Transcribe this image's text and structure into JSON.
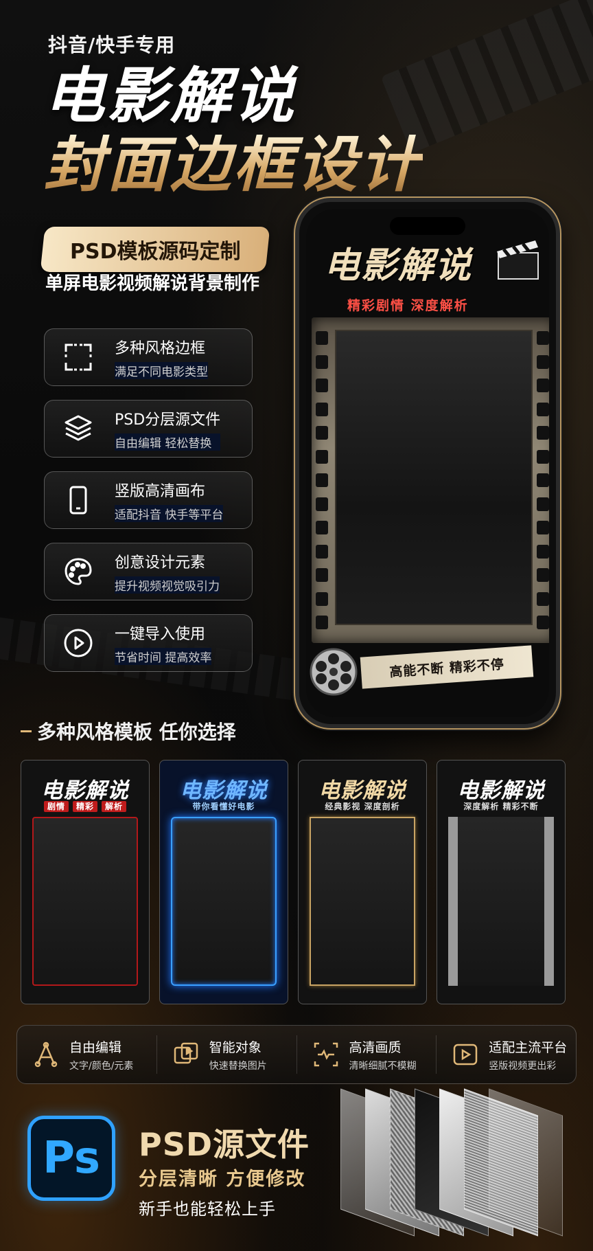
{
  "header": {
    "tag": "抖音/快手专用",
    "title_line1": "电影解说",
    "title_line2": "封面边框设计",
    "pill": "PSD模板源码定制",
    "subline": "单屏电影视频解说背景制作"
  },
  "features": [
    {
      "title": "多种风格边框",
      "desc": "满足不同电影类型",
      "icon": "frame-icon"
    },
    {
      "title": "PSD分层源文件",
      "desc": "自由编辑 轻松替换",
      "icon": "layers-icon"
    },
    {
      "title": "竖版高清画布",
      "desc": "适配抖音 快手等平台",
      "icon": "phone-icon"
    },
    {
      "title": "创意设计元素",
      "desc": "提升视频视觉吸引力",
      "icon": "palette-icon"
    },
    {
      "title": "一键导入使用",
      "desc": "节省时间 提高效率",
      "icon": "play-icon"
    }
  ],
  "phone": {
    "title": "电影解说",
    "subtitle": "精彩剧情 深度解析",
    "banner": "高能不断 精彩不停"
  },
  "templates_section": {
    "title": "多种风格模板 任你选择"
  },
  "templates": [
    {
      "title": "电影解说",
      "tags": [
        "剧情",
        "精彩",
        "解析"
      ]
    },
    {
      "title": "电影解说",
      "sub": "带你看懂好电影"
    },
    {
      "title": "电影解说",
      "sub": "经典影视 深度剖析"
    },
    {
      "title": "电影解说",
      "sub": "深度解析 精彩不断"
    }
  ],
  "bottom_bar": [
    {
      "title": "自由编辑",
      "desc": "文字/颜色/元素",
      "icon": "edit-icon"
    },
    {
      "title": "智能对象",
      "desc": "快速替换图片",
      "icon": "smart-object-icon"
    },
    {
      "title": "高清画质",
      "desc": "清晰细腻不模糊",
      "icon": "hd-icon"
    },
    {
      "title": "适配主流平台",
      "desc": "竖版视频更出彩",
      "icon": "platform-icon"
    }
  ],
  "psd": {
    "logo": "Ps",
    "title": "PSD源文件",
    "line1": "分层清晰 方便修改",
    "line2": "新手也能轻松上手"
  },
  "colors": {
    "gold": "#e0b878",
    "red": "#ff5046",
    "blue": "#31a8ff"
  }
}
